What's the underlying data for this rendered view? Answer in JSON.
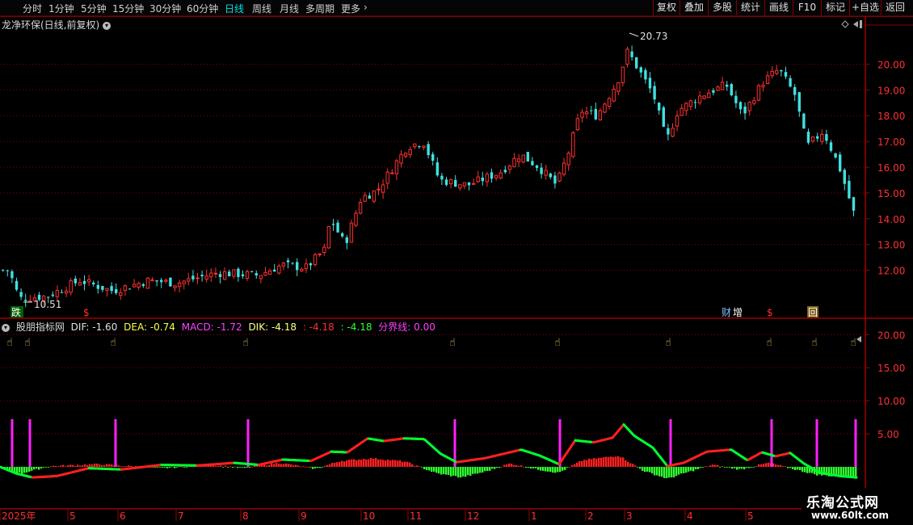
{
  "toolbar": {
    "periods": [
      "分时",
      "1分钟",
      "5分钟",
      "15分钟",
      "30分钟",
      "60分钟",
      "日线",
      "周线",
      "月线",
      "多周期",
      "更多"
    ],
    "active_period": "日线",
    "right_buttons": [
      "复权",
      "叠加",
      "多股",
      "统计",
      "画线",
      "F10",
      "标记",
      "+自选",
      "返回"
    ]
  },
  "title": {
    "stock": "龙净环保(日线,前复权)"
  },
  "indicator": {
    "name": "股朋指标网",
    "dif": "DIF: -1.60",
    "dea": "DEA: -0.74",
    "macd": "MACD: -1.72",
    "dik": "DIK: -4.18",
    "red": ": -4.18",
    "green": ": -4.18",
    "boundary": "分界线: 0.00"
  },
  "colors": {
    "bg": "#000000",
    "grid": "#8b0000",
    "up": "#ff3030",
    "down": "#40e0e0",
    "dif": "#ff2020",
    "dea": "#00ff30",
    "signal": "#ff20ff",
    "vol_up": "#ff2020",
    "vol_down": "#30ff30"
  },
  "markers": {
    "diemarker": "跌",
    "dollar": "$",
    "cai": "财",
    "zeng": "增",
    "hui": "回"
  },
  "chart_data": [
    {
      "type": "candlestick",
      "title": "龙净环保(日线,前复权)",
      "y_ticks": [
        12.0,
        13.0,
        14.0,
        15.0,
        16.0,
        17.0,
        18.0,
        19.0,
        20.0
      ],
      "ylim": [
        10.2,
        21.3
      ],
      "high_label": "20.73",
      "low_label": "10.51",
      "keypoints": [
        {
          "x": 0,
          "v": 12.0
        },
        {
          "x": 12,
          "v": 12.0
        },
        {
          "x": 25,
          "v": 10.9
        },
        {
          "x": 60,
          "v": 11.0
        },
        {
          "x": 100,
          "v": 11.6
        },
        {
          "x": 140,
          "v": 11.2
        },
        {
          "x": 185,
          "v": 11.6
        },
        {
          "x": 220,
          "v": 11.5
        },
        {
          "x": 270,
          "v": 11.9
        },
        {
          "x": 320,
          "v": 11.8
        },
        {
          "x": 350,
          "v": 12.2
        },
        {
          "x": 380,
          "v": 12.1
        },
        {
          "x": 403,
          "v": 12.8
        },
        {
          "x": 410,
          "v": 14.0
        },
        {
          "x": 428,
          "v": 13.0
        },
        {
          "x": 448,
          "v": 14.8
        },
        {
          "x": 468,
          "v": 15.1
        },
        {
          "x": 505,
          "v": 16.8
        },
        {
          "x": 525,
          "v": 17.0
        },
        {
          "x": 545,
          "v": 15.5
        },
        {
          "x": 580,
          "v": 15.3
        },
        {
          "x": 620,
          "v": 15.8
        },
        {
          "x": 645,
          "v": 16.5
        },
        {
          "x": 668,
          "v": 16.0
        },
        {
          "x": 690,
          "v": 15.3
        },
        {
          "x": 705,
          "v": 16.6
        },
        {
          "x": 720,
          "v": 18.2
        },
        {
          "x": 740,
          "v": 18.0
        },
        {
          "x": 765,
          "v": 19.3
        },
        {
          "x": 778,
          "v": 20.5
        },
        {
          "x": 795,
          "v": 19.6
        },
        {
          "x": 810,
          "v": 18.8
        },
        {
          "x": 826,
          "v": 17.0
        },
        {
          "x": 840,
          "v": 18.2
        },
        {
          "x": 870,
          "v": 18.8
        },
        {
          "x": 900,
          "v": 19.2
        },
        {
          "x": 920,
          "v": 18.0
        },
        {
          "x": 945,
          "v": 19.3
        },
        {
          "x": 965,
          "v": 19.8
        },
        {
          "x": 985,
          "v": 18.8
        },
        {
          "x": 1000,
          "v": 16.8
        },
        {
          "x": 1020,
          "v": 17.4
        },
        {
          "x": 1040,
          "v": 16.0
        },
        {
          "x": 1060,
          "v": 14.0
        }
      ]
    },
    {
      "type": "line",
      "name": "股朋指标网",
      "y_ticks": [
        5.0,
        10.0,
        15.0,
        20.0
      ],
      "ylim": [
        -2.2,
        21.5
      ],
      "dif_keypoints": [
        {
          "x": 0,
          "v": 0.0
        },
        {
          "x": 20,
          "v": -1.0
        },
        {
          "x": 40,
          "v": -1.6
        },
        {
          "x": 70,
          "v": -1.4
        },
        {
          "x": 110,
          "v": -0.2
        },
        {
          "x": 150,
          "v": -0.4
        },
        {
          "x": 200,
          "v": 0.3
        },
        {
          "x": 245,
          "v": 0.2
        },
        {
          "x": 290,
          "v": 0.6
        },
        {
          "x": 320,
          "v": 0.3
        },
        {
          "x": 350,
          "v": 1.1
        },
        {
          "x": 385,
          "v": 0.9
        },
        {
          "x": 410,
          "v": 2.3
        },
        {
          "x": 430,
          "v": 2.2
        },
        {
          "x": 455,
          "v": 4.3
        },
        {
          "x": 475,
          "v": 3.9
        },
        {
          "x": 500,
          "v": 4.3
        },
        {
          "x": 525,
          "v": 4.2
        },
        {
          "x": 545,
          "v": 2.0
        },
        {
          "x": 565,
          "v": 0.7
        },
        {
          "x": 600,
          "v": 1.3
        },
        {
          "x": 645,
          "v": 2.6
        },
        {
          "x": 668,
          "v": 1.7
        },
        {
          "x": 692,
          "v": 0.4
        },
        {
          "x": 712,
          "v": 4.0
        },
        {
          "x": 735,
          "v": 3.7
        },
        {
          "x": 758,
          "v": 4.4
        },
        {
          "x": 772,
          "v": 6.4
        },
        {
          "x": 785,
          "v": 4.7
        },
        {
          "x": 808,
          "v": 2.9
        },
        {
          "x": 826,
          "v": 0.1
        },
        {
          "x": 846,
          "v": 0.6
        },
        {
          "x": 875,
          "v": 2.3
        },
        {
          "x": 905,
          "v": 2.6
        },
        {
          "x": 925,
          "v": 1.0
        },
        {
          "x": 943,
          "v": 2.2
        },
        {
          "x": 960,
          "v": 1.6
        },
        {
          "x": 978,
          "v": 2.1
        },
        {
          "x": 995,
          "v": 0.5
        },
        {
          "x": 1015,
          "v": -0.9
        },
        {
          "x": 1040,
          "v": -1.4
        },
        {
          "x": 1060,
          "v": -1.6
        }
      ],
      "signals_x": [
        15,
        37,
        143,
        307,
        563,
        693,
        830,
        955,
        1011,
        1059
      ],
      "macd_bars": [
        {
          "x": 0,
          "v": -0.3
        },
        {
          "x": 25,
          "v": -1.0
        },
        {
          "x": 60,
          "v": 0.1
        },
        {
          "x": 120,
          "v": 0.4
        },
        {
          "x": 200,
          "v": -0.2
        },
        {
          "x": 260,
          "v": 0.3
        },
        {
          "x": 300,
          "v": -0.2
        },
        {
          "x": 345,
          "v": 0.6
        },
        {
          "x": 390,
          "v": -0.3
        },
        {
          "x": 420,
          "v": 0.9
        },
        {
          "x": 460,
          "v": 1.3
        },
        {
          "x": 500,
          "v": 0.8
        },
        {
          "x": 540,
          "v": -1.0
        },
        {
          "x": 570,
          "v": -1.6
        },
        {
          "x": 600,
          "v": -0.7
        },
        {
          "x": 630,
          "v": 0.5
        },
        {
          "x": 665,
          "v": -0.4
        },
        {
          "x": 690,
          "v": -0.9
        },
        {
          "x": 720,
          "v": 1.0
        },
        {
          "x": 765,
          "v": 1.7
        },
        {
          "x": 795,
          "v": -0.6
        },
        {
          "x": 825,
          "v": -1.8
        },
        {
          "x": 850,
          "v": -0.8
        },
        {
          "x": 880,
          "v": 0.3
        },
        {
          "x": 915,
          "v": -0.4
        },
        {
          "x": 950,
          "v": 0.6
        },
        {
          "x": 980,
          "v": -0.3
        },
        {
          "x": 1010,
          "v": -1.2
        },
        {
          "x": 1060,
          "v": -1.7
        }
      ],
      "x_labels": [
        {
          "label": "2025年",
          "x": 2
        },
        {
          "label": "5",
          "x": 86
        },
        {
          "label": "6",
          "x": 148
        },
        {
          "label": "7",
          "x": 220
        },
        {
          "label": "8",
          "x": 300
        },
        {
          "label": "9",
          "x": 372
        },
        {
          "label": "10",
          "x": 449
        },
        {
          "label": "11",
          "x": 507
        },
        {
          "label": "12",
          "x": 578
        },
        {
          "label": "1",
          "x": 657
        },
        {
          "label": "2",
          "x": 727
        },
        {
          "label": "3",
          "x": 775
        },
        {
          "label": "4",
          "x": 850
        },
        {
          "label": "5",
          "x": 925
        }
      ]
    }
  ],
  "watermark": {
    "line1": "乐淘公式网",
    "line2": "www.60lt.com"
  }
}
